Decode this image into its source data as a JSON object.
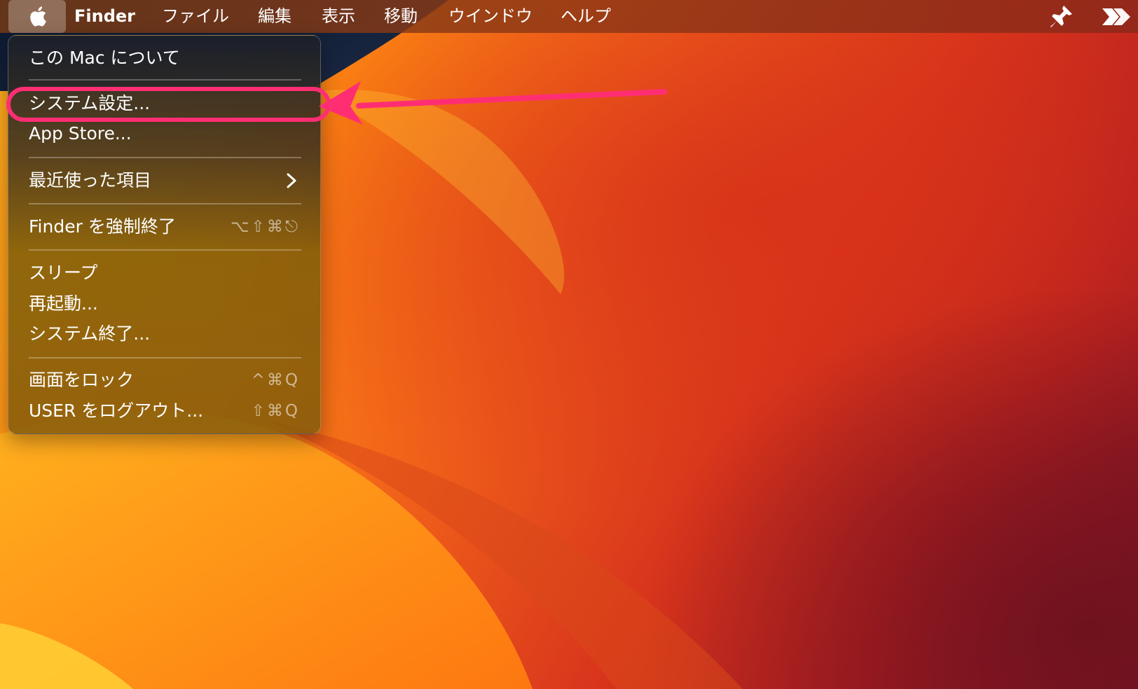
{
  "menubar": {
    "apple_icon": "apple-logo",
    "app_name": "Finder",
    "items": [
      "ファイル",
      "編集",
      "表示",
      "移動",
      "ウインドウ",
      "ヘルプ"
    ],
    "right_icons": [
      "pin-icon",
      "double-chevron-icon"
    ]
  },
  "apple_menu": {
    "about": "この Mac について",
    "system_settings": "システム設定...",
    "app_store": "App Store...",
    "recent_items": "最近使った項目",
    "force_quit": "Finder を強制終了",
    "force_quit_shortcut": "⌥⇧⌘⎋",
    "sleep": "スリープ",
    "restart": "再起動...",
    "shutdown": "システム終了...",
    "lock_screen": "画面をロック",
    "lock_screen_shortcut": "^⌘Q",
    "logout": "USER をログアウト...",
    "logout_shortcut": "⇧⌘Q"
  },
  "annotation": {
    "highlight_color": "#ff2e73"
  }
}
